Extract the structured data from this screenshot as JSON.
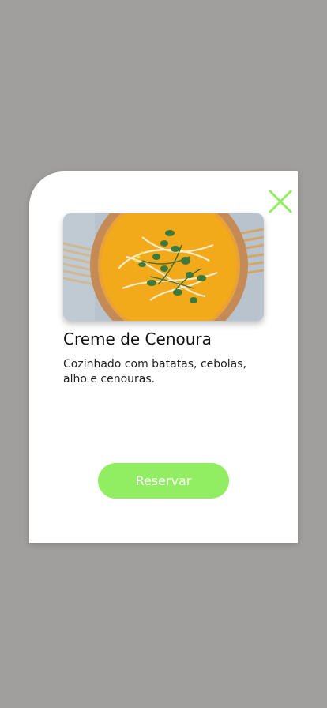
{
  "modal": {
    "close_icon": "close-icon",
    "dish": {
      "image_icon": "carrot-soup-photo",
      "title": "Creme de Cenoura",
      "description": "Cozinhado com batatas, cebolas, alho e cenouras."
    },
    "reserve_label": "Reservar"
  },
  "colors": {
    "backdrop": "#a19f9d",
    "accent": "#91ed62",
    "soup": "#f2a91a"
  }
}
